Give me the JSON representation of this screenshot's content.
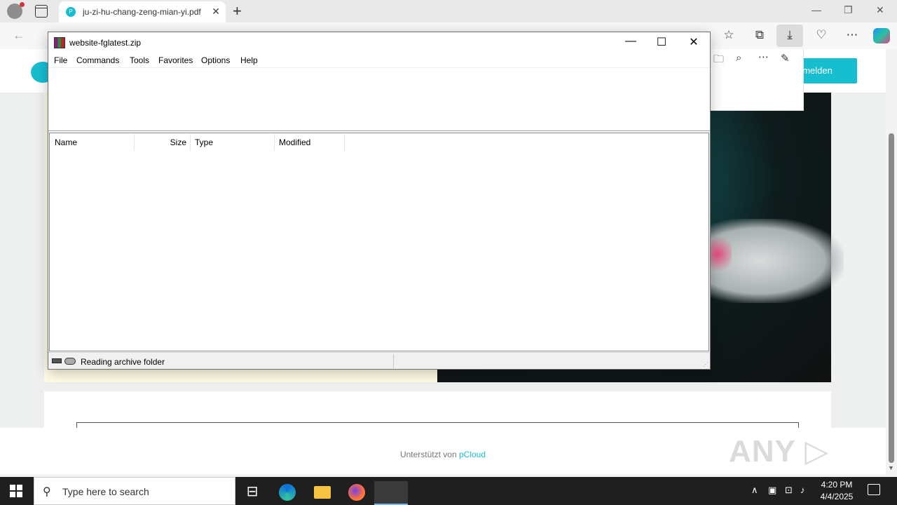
{
  "browser": {
    "tab": {
      "title": "ju-zi-hu-chang-zeng-mian-yi.pdf",
      "favicon_text": "P"
    },
    "controls": {
      "minimize": "—",
      "restore": "❐",
      "close": "✕",
      "new_tab": "+",
      "tab_close": "✕"
    }
  },
  "webpage": {
    "login_label": "nmelden",
    "footer": {
      "prefix": "Unterstützt von",
      "brand": "pCloud"
    },
    "watermark": "ANY ▷ RUN",
    "accent": "#17bed0"
  },
  "winrar": {
    "title": "website-fglatest.zip",
    "menu": [
      "File",
      "Commands",
      "Tools",
      "Favorites",
      "Options",
      "Help"
    ],
    "columns": [
      "Name",
      "Size",
      "Type",
      "Modified"
    ],
    "status": "Reading archive folder"
  },
  "taskbar": {
    "search_placeholder": "Type here to search",
    "time": "4:20 PM",
    "date": "4/4/2025"
  }
}
